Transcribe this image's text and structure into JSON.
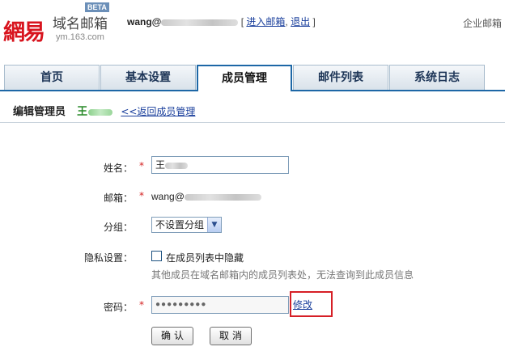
{
  "brand": {
    "logo_text": "網易",
    "product": "域名邮箱",
    "beta": "BETA",
    "domain": "ym.163.com"
  },
  "user": {
    "email_prefix": "wang@",
    "bracket_open": "[",
    "enter_mail": "进入邮箱",
    "separator": ",",
    "logout": "退出",
    "bracket_close": "]"
  },
  "enterprise_link": "企业邮箱",
  "tabs": [
    {
      "label": "首页",
      "active": false
    },
    {
      "label": "基本设置",
      "active": false
    },
    {
      "label": "成员管理",
      "active": true
    },
    {
      "label": "邮件列表",
      "active": false
    },
    {
      "label": "系统日志",
      "active": false
    }
  ],
  "section": {
    "title": "编辑管理员",
    "admin_name": "王",
    "back_link": "<<返回成员管理"
  },
  "form": {
    "name_label": "姓名：",
    "name_value": "王",
    "email_label": "邮箱：",
    "email_value": "wang@",
    "group_label": "分组：",
    "group_value": "不设置分组",
    "privacy_label": "隐私设置：",
    "privacy_option": "在成员列表中隐藏",
    "privacy_hint": "其他成员在域名邮箱内的成员列表处，无法查询到此成员信息",
    "password_label": "密码：",
    "password_mask": "●●●●●●●●●",
    "modify_link": "修改",
    "required_mark": "*",
    "privacy_checked": false
  },
  "buttons": {
    "confirm": "确认",
    "cancel": "取消"
  },
  "colors": {
    "accent": "#1d67a6",
    "highlight_box": "#d61f26",
    "link": "#1a3f9c",
    "required": "#d31f1f"
  }
}
